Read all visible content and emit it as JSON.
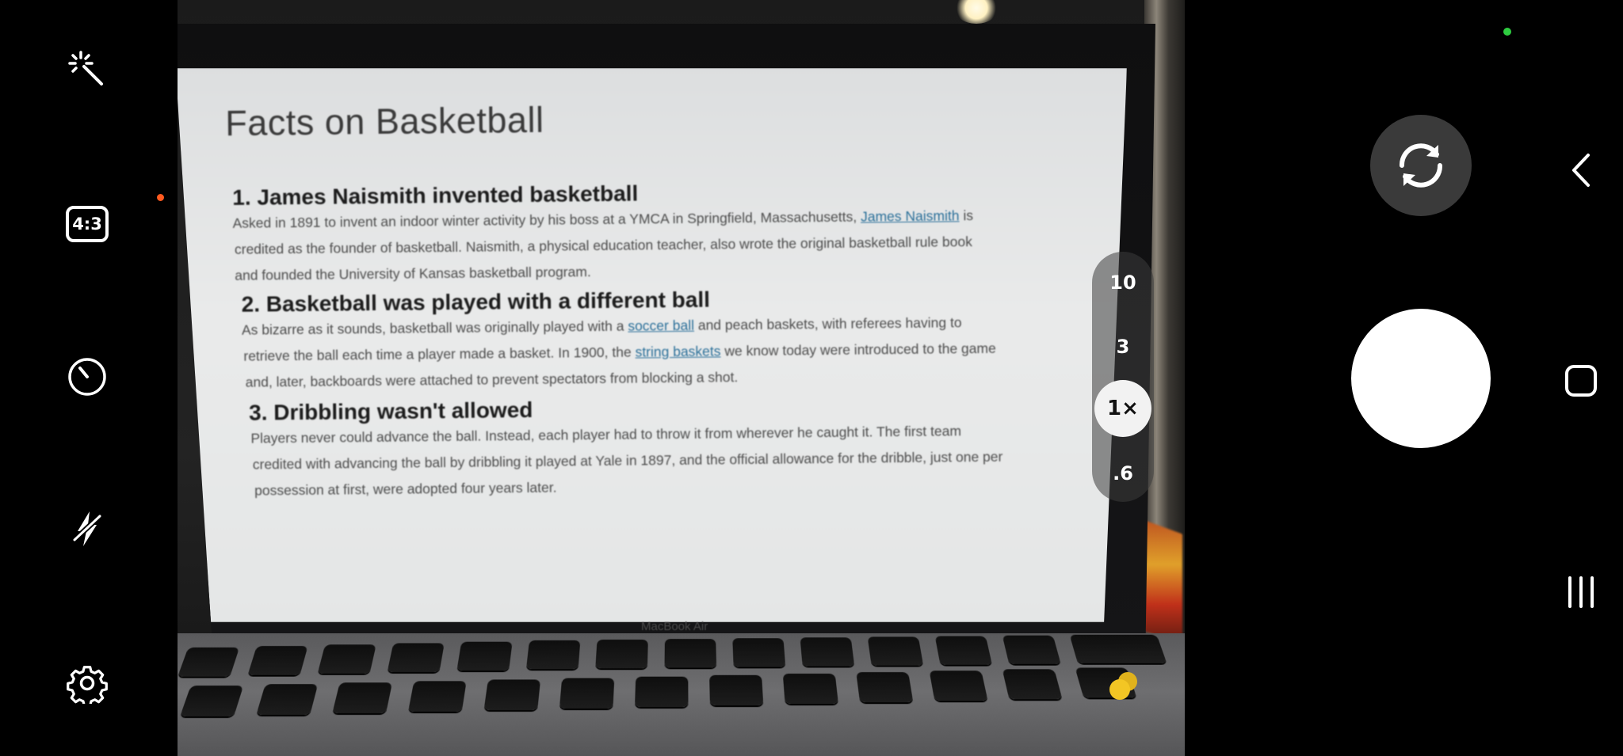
{
  "left_rail": {
    "effects_icon": "magic-wand-icon",
    "aspect_ratio_label": "4:3",
    "timer_icon": "timer-icon",
    "flash_icon": "flash-off-icon",
    "settings_icon": "gear-icon",
    "notification_dot_color": "#ff5a1f"
  },
  "viewfinder": {
    "document": {
      "title": "Facts on Basketball",
      "sections": [
        {
          "heading": "1. James Naismith invented basketball",
          "lines": [
            "Asked in 1891 to invent an indoor winter activity by his boss at a YMCA in Springfield, Massachusetts,",
            "credited as the founder of basketball. Naismith, a physical education teacher, also wrote the original basketball rule book",
            "and founded the University of Kansas basketball program."
          ],
          "link_1": "James Naismith",
          "after_link_1": " is"
        },
        {
          "heading": "2. Basketball was played with a different ball",
          "line1_before": "As bizarre as it sounds, basketball was originally played with a ",
          "link_1": "soccer ball",
          "line1_after": " and peach baskets, with referees having to",
          "line2_before": "retrieve the ball each time a player made a basket. In 1900, the ",
          "link_2": "string baskets",
          "line2_after": " we know today were introduced to the game",
          "line3": "and, later, backboards were attached to prevent spectators from blocking a shot."
        },
        {
          "heading": "3. Dribbling wasn't allowed",
          "lines": [
            "Players never could advance the ball. Instead, each player had to throw it from wherever he caught it. The first team",
            "credited with advancing the ball by dribbling it played at Yale in 1897, and the official allowance for the dribble, just one per",
            "possession at first, were adopted four years later."
          ]
        }
      ],
      "link_color": "#2a6f99"
    },
    "laptop_brand": "MacBook Air"
  },
  "zoom": {
    "options": [
      "10",
      "3",
      "1×",
      ".6"
    ],
    "selected": "1×"
  },
  "right_panel": {
    "switch_camera_icon": "switch-camera-icon",
    "shutter_label": "",
    "status_dot_color": "#2ecc40",
    "nav": {
      "back_icon": "back-chevron-icon",
      "home_icon": "home-square-icon",
      "recents_icon": "recents-icon"
    }
  }
}
